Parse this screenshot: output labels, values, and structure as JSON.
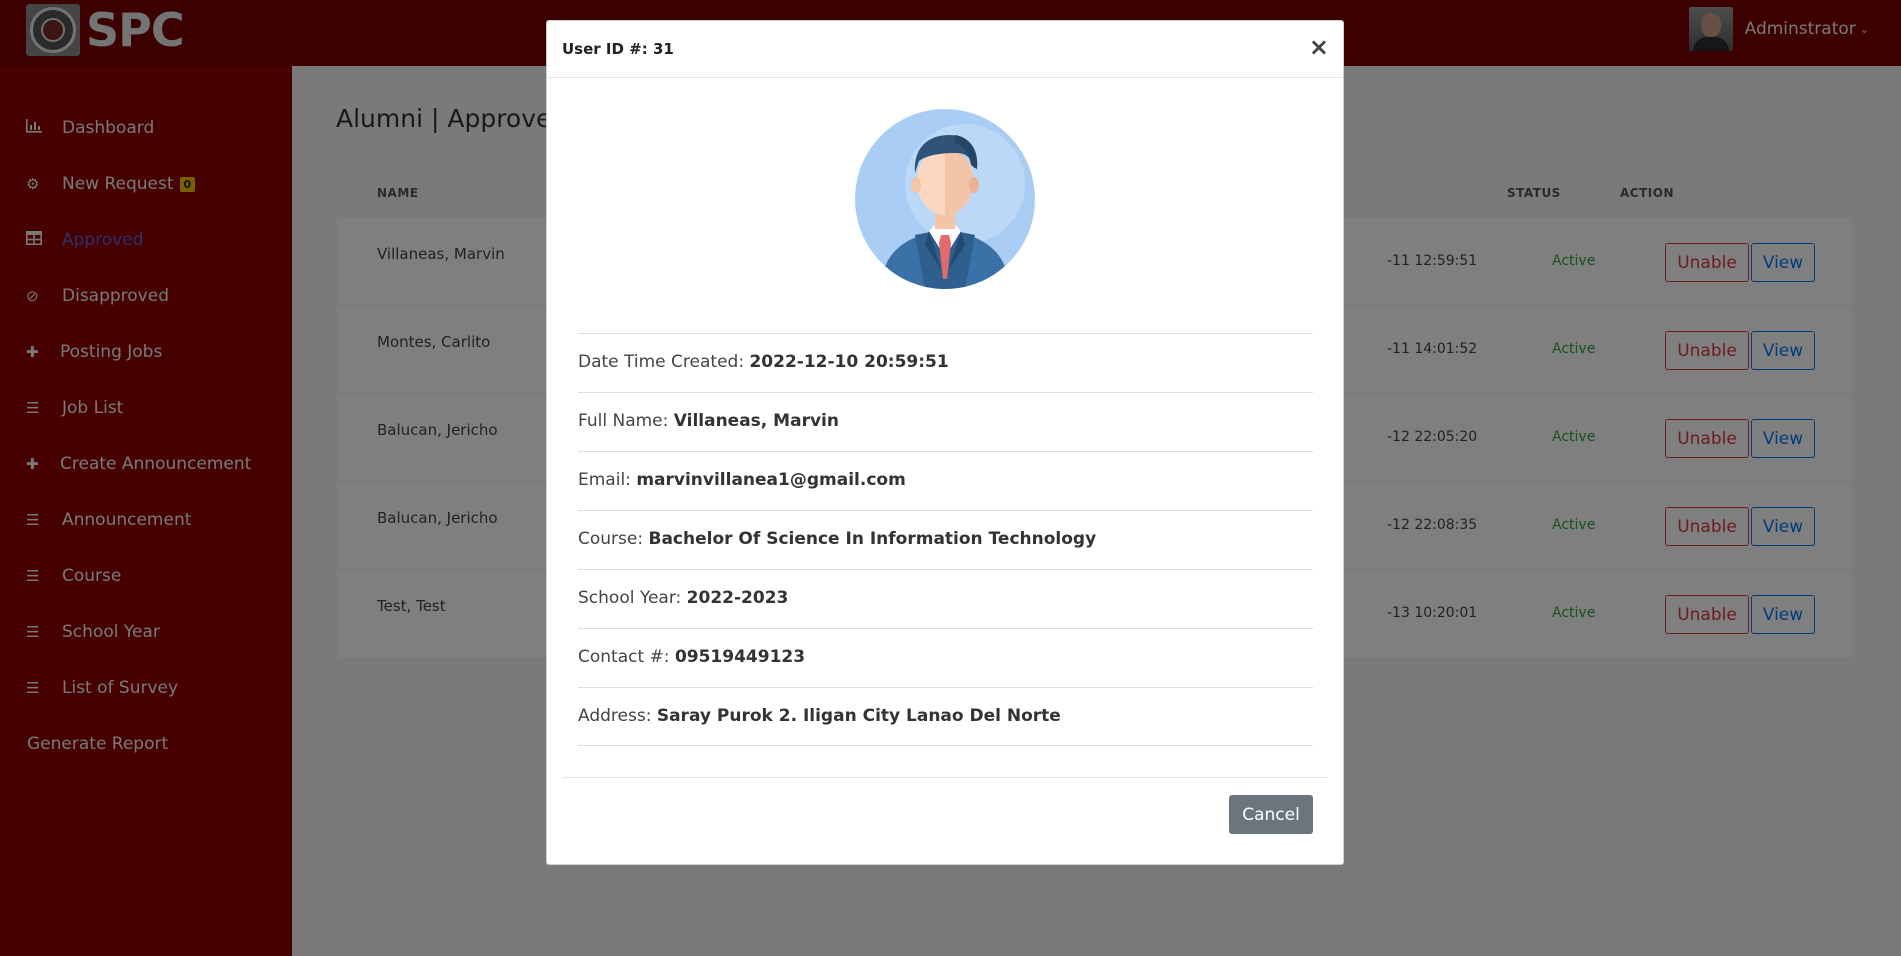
{
  "header": {
    "logo_text": "SPC",
    "user_name": "Adminstrator"
  },
  "sidebar": {
    "items": [
      {
        "label": "Dashboard",
        "icon": "bar-chart-icon"
      },
      {
        "label": "New Request",
        "icon": "gear-icon",
        "badge": "0"
      },
      {
        "label": "Approved",
        "icon": "table-icon",
        "active": true
      },
      {
        "label": "Disapproved",
        "icon": "ban-icon"
      },
      {
        "label": "Posting Jobs",
        "icon": "plus-icon"
      },
      {
        "label": "Job List",
        "icon": "list-icon"
      },
      {
        "label": "Create Announcement",
        "icon": "plus-icon"
      },
      {
        "label": "Announcement",
        "icon": "list-icon"
      },
      {
        "label": "Course",
        "icon": "list-icon"
      },
      {
        "label": "School Year",
        "icon": "list-icon"
      },
      {
        "label": "List of Survey",
        "icon": "list-icon"
      },
      {
        "label": "Generate Report",
        "icon": ""
      }
    ]
  },
  "main": {
    "title": "Alumni | Approved",
    "columns": [
      "NAME",
      "STATUS",
      "ACTION"
    ],
    "rows": [
      {
        "name": "Villaneas, Marvin",
        "date": "-11 12:59:51",
        "status": "Active"
      },
      {
        "name": "Montes, Carlito",
        "date": "-11 14:01:52",
        "status": "Active"
      },
      {
        "name": "Balucan, Jericho",
        "date": "-12 22:05:20",
        "status": "Active"
      },
      {
        "name": "Balucan, Jericho",
        "date": "-12 22:08:35",
        "status": "Active"
      },
      {
        "name": "Test, Test",
        "date": "-13 10:20:01",
        "status": "Active"
      }
    ],
    "unable_label": "Unable",
    "view_label": "View"
  },
  "modal": {
    "title": "User ID #: 31",
    "close_glyph": "×",
    "fields": [
      {
        "label": "Date Time Created:",
        "value": "2022-12-10 20:59:51"
      },
      {
        "label": "Full Name:",
        "value": "Villaneas, Marvin"
      },
      {
        "label": "Email:",
        "value": "marvinvillanea1@gmail.com"
      },
      {
        "label": "Course:",
        "value": "Bachelor Of Science In Information Technology"
      },
      {
        "label": "School Year:",
        "value": "2022-2023"
      },
      {
        "label": "Contact #:",
        "value": "09519449123"
      },
      {
        "label": "Address:",
        "value": "Saray Purok 2. Iligan City Lanao Del Norte"
      }
    ],
    "cancel_label": "Cancel"
  },
  "colors": {
    "topbar": "#7a0000",
    "sidebar": "#8c0000",
    "active_link": "#5b63d6",
    "status_active": "#28a745",
    "danger": "#dc3545",
    "primary": "#007bff",
    "secondary": "#6c757d"
  }
}
